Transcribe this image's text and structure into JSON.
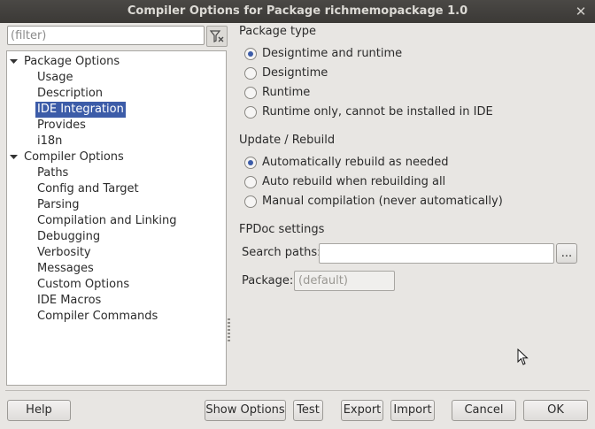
{
  "window": {
    "title": "Compiler Options for Package richmemopackage 1.0",
    "close_glyph": "✕"
  },
  "filter": {
    "placeholder": "(filter)",
    "clear_icon": "filter-clear-icon"
  },
  "tree": {
    "items": [
      {
        "label": "Package Options",
        "level": 0,
        "expanded": true
      },
      {
        "label": "Usage",
        "level": 1
      },
      {
        "label": "Description",
        "level": 1
      },
      {
        "label": "IDE Integration",
        "level": 1,
        "selected": true
      },
      {
        "label": "Provides",
        "level": 1
      },
      {
        "label": "i18n",
        "level": 1
      },
      {
        "label": "Compiler Options",
        "level": 0,
        "expanded": true
      },
      {
        "label": "Paths",
        "level": 1
      },
      {
        "label": "Config and Target",
        "level": 1
      },
      {
        "label": "Parsing",
        "level": 1
      },
      {
        "label": "Compilation and Linking",
        "level": 1
      },
      {
        "label": "Debugging",
        "level": 1
      },
      {
        "label": "Verbosity",
        "level": 1
      },
      {
        "label": "Messages",
        "level": 1
      },
      {
        "label": "Custom Options",
        "level": 1
      },
      {
        "label": "IDE Macros",
        "level": 1
      },
      {
        "label": "Compiler Commands",
        "level": 1
      }
    ]
  },
  "package_type": {
    "title": "Package type",
    "options": [
      {
        "label": "Designtime and runtime",
        "checked": true
      },
      {
        "label": "Designtime",
        "checked": false
      },
      {
        "label": "Runtime",
        "checked": false
      },
      {
        "label": "Runtime only, cannot be installed in IDE",
        "checked": false
      }
    ]
  },
  "update_rebuild": {
    "title": "Update / Rebuild",
    "options": [
      {
        "label": "Automatically rebuild as needed",
        "checked": true
      },
      {
        "label": "Auto rebuild when rebuilding all",
        "checked": false
      },
      {
        "label": "Manual compilation (never automatically)",
        "checked": false
      }
    ]
  },
  "fpdoc": {
    "title": "FPDoc settings",
    "search_paths_label": "Search paths:",
    "search_paths_value": "",
    "browse_label": "...",
    "package_label": "Package:",
    "package_placeholder": "(default)"
  },
  "buttons": {
    "help": "Help",
    "show_options": "Show Options",
    "test": "Test",
    "export": "Export",
    "import": "Import",
    "cancel": "Cancel",
    "ok": "OK"
  },
  "colors": {
    "selection": "#3c5ca8",
    "titlebar": "#3b3936",
    "background": "#e8e6e3"
  }
}
